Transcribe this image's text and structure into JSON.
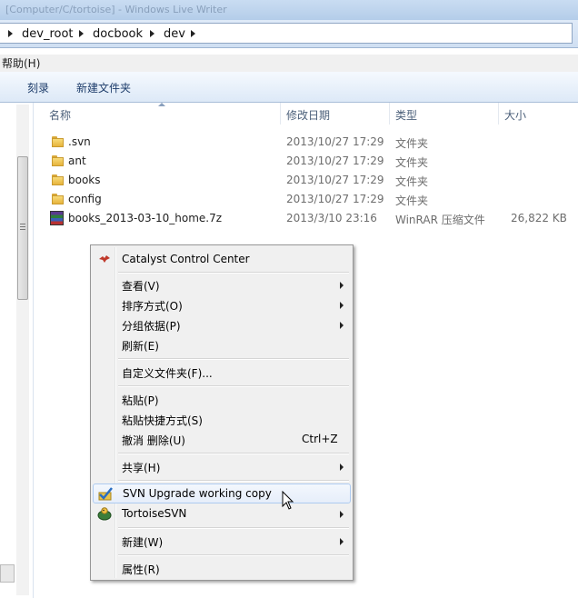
{
  "window": {
    "title": "[Computer/C/tortoise] - Windows Live Writer"
  },
  "address": {
    "crumbs": [
      "dev_root",
      "docbook",
      "dev"
    ]
  },
  "menubar": {
    "items": [
      "帮助(H)"
    ]
  },
  "toolbar": {
    "buttons": [
      "刻录",
      "新建文件夹"
    ]
  },
  "columns": {
    "name": "名称",
    "date": "修改日期",
    "type": "类型",
    "size": "大小"
  },
  "files": [
    {
      "name": ".svn",
      "date": "2013/10/27 17:29",
      "type": "文件夹",
      "size": "",
      "icon": "folder-icon"
    },
    {
      "name": "ant",
      "date": "2013/10/27 17:29",
      "type": "文件夹",
      "size": "",
      "icon": "folder-icon"
    },
    {
      "name": "books",
      "date": "2013/10/27 17:29",
      "type": "文件夹",
      "size": "",
      "icon": "folder-icon"
    },
    {
      "name": "config",
      "date": "2013/10/27 17:29",
      "type": "文件夹",
      "size": "",
      "icon": "folder-icon"
    },
    {
      "name": "books_2013-03-10_home.7z",
      "date": "2013/3/10 23:16",
      "type": "WinRAR 压缩文件",
      "size": "26,822 KB",
      "icon": "winrar-archive-icon"
    }
  ],
  "context_menu": {
    "items": [
      {
        "label": "Catalyst Control Center",
        "icon": "catalyst-icon"
      },
      {
        "label": "查看(V)",
        "submenu": true
      },
      {
        "label": "排序方式(O)",
        "submenu": true
      },
      {
        "label": "分组依据(P)",
        "submenu": true
      },
      {
        "label": "刷新(E)"
      },
      {
        "label": "自定义文件夹(F)..."
      },
      {
        "label": "粘贴(P)"
      },
      {
        "label": "粘贴快捷方式(S)"
      },
      {
        "label": "撤消 删除(U)",
        "shortcut": "Ctrl+Z"
      },
      {
        "label": "共享(H)",
        "submenu": true
      },
      {
        "label": "SVN Upgrade working copy",
        "icon": "svn-upgrade-icon",
        "highlighted": true
      },
      {
        "label": "TortoiseSVN",
        "icon": "tortoisesvn-icon",
        "submenu": true
      },
      {
        "label": "新建(W)",
        "submenu": true
      },
      {
        "label": "属性(R)"
      }
    ]
  },
  "colors": {
    "highlight_border": "#aecbf0",
    "folder": "#e7b43c",
    "menu_bg": "#f0f0f0"
  }
}
